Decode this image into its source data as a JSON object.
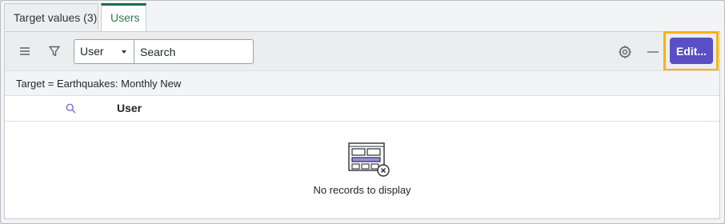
{
  "tabs": [
    {
      "label": "Target values (3)",
      "active": false
    },
    {
      "label": "Users",
      "active": true
    }
  ],
  "toolbar": {
    "menu_icon": "hamburger-menu-icon",
    "filter_icon": "funnel-filter-icon",
    "field_select": {
      "selected": "User"
    },
    "search": {
      "placeholder": "Search",
      "value": ""
    },
    "settings_icon": "gear-icon",
    "collapse_icon": "minus-icon",
    "edit_label": "Edit..."
  },
  "breadcrumb": "Target = Earthquakes: Monthly New",
  "table": {
    "columns": [
      "User"
    ],
    "rows": []
  },
  "empty_state": {
    "message": "No records to display",
    "icon": "empty-list-icon"
  },
  "colors": {
    "accent": "#5a4fc4",
    "highlight": "#f5b301",
    "active_tab": "#1d6c47"
  }
}
